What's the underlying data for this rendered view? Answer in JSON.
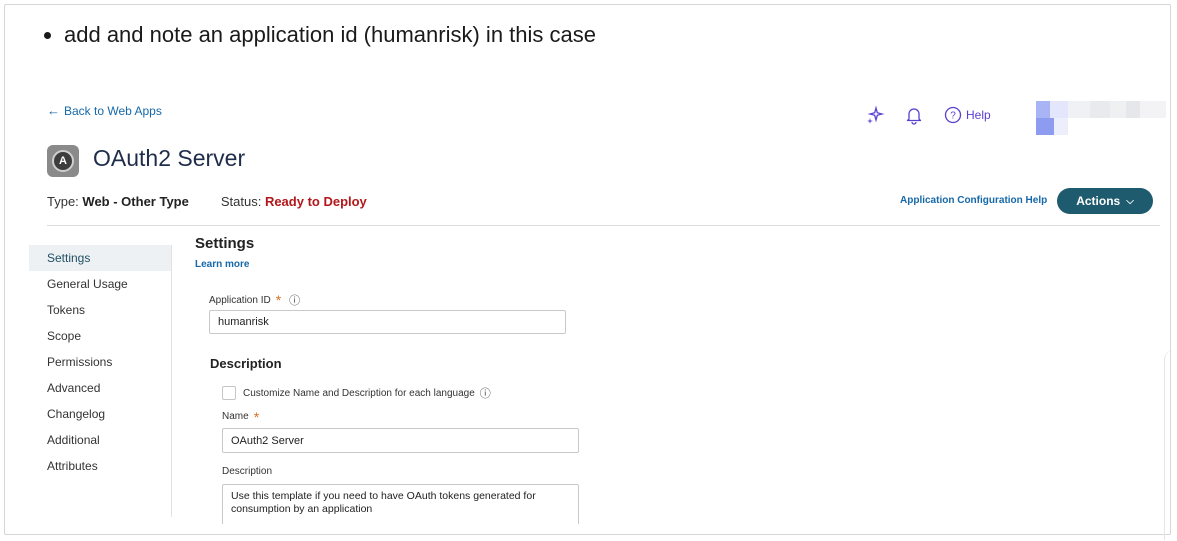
{
  "note": "add and note an application id (humanrisk) in this case",
  "nav": {
    "back_label": "Back to Web Apps",
    "help_label": "Help"
  },
  "icons": {
    "sparkle": "sparkle-icon",
    "bell": "bell-icon",
    "help": "help-circle-icon",
    "back": "arrow-left-icon",
    "info": "info-icon",
    "chevron": "chevron-down-icon"
  },
  "app": {
    "title": "OAuth2 Server",
    "type_label": "Type:",
    "type_value": "Web - Other Type",
    "status_label": "Status:",
    "status_value": "Ready to Deploy"
  },
  "header": {
    "config_help": "Application Configuration Help",
    "actions_label": "Actions"
  },
  "sidebar": {
    "items": [
      {
        "label": "Settings",
        "active": true
      },
      {
        "label": "General Usage"
      },
      {
        "label": "Tokens"
      },
      {
        "label": "Scope"
      },
      {
        "label": "Permissions"
      },
      {
        "label": "Advanced"
      },
      {
        "label": "Changelog"
      },
      {
        "label": "Additional Attributes"
      }
    ]
  },
  "settings": {
    "title": "Settings",
    "learn_more": "Learn more",
    "app_id_label": "Application ID",
    "app_id_value": "humanrisk",
    "description_heading": "Description",
    "customize_label": "Customize Name and Description for each language",
    "name_label": "Name",
    "name_value": "OAuth2 Server",
    "description_label": "Description",
    "description_value": "Use this template if you need to have OAuth tokens generated for consumption by an application"
  },
  "colors": {
    "accent": "#1e5b6e",
    "link": "#1668a8",
    "status": "#b3161b",
    "required": "#e06e1c",
    "help": "#5a3fd1"
  }
}
